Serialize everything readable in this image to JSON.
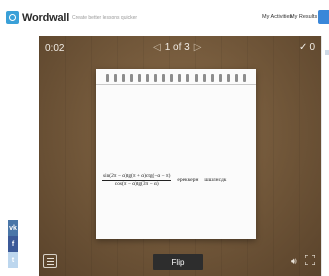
{
  "header": {
    "logo_text": "Wordwall",
    "tagline": "Create better lessons quicker",
    "nav_my_activities": "My Activities",
    "nav_my_results": "My Results"
  },
  "game": {
    "timer": "0:02",
    "counter": "1 of 3",
    "score": "0",
    "card": {
      "formula_numerator": "sin(2π − α)tg(π + α)ctg(−α − π)",
      "formula_denominator": "cos(π − α)tg(3π − α)",
      "word_1": "ереккерн",
      "word_2": "шшлнсдк"
    },
    "flip_label": "Flip"
  },
  "social": {
    "vk_label": "vk",
    "fb_label": "f",
    "tw_label": "t"
  },
  "colors": {
    "accent": "#3a87d9",
    "stage": "#6f5538",
    "flip_button": "#2d2d2d"
  }
}
